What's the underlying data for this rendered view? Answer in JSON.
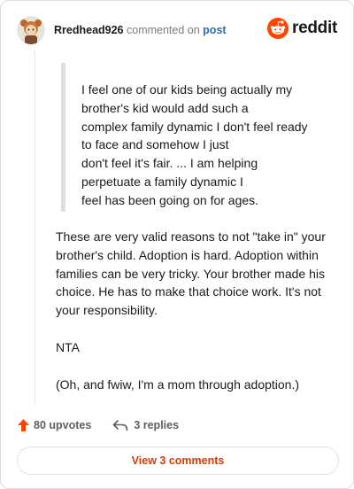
{
  "header": {
    "username": "Rredhead926",
    "action_text": "commented on",
    "post_link": "post",
    "brand": "reddit"
  },
  "colors": {
    "accent": "#d93a00",
    "upvote": "#ff4500",
    "link": "#2e6bb4"
  },
  "quote": {
    "lines": [
      "I feel one of our kids being actually my",
      "brother's kid would add such a",
      "complex family dynamic I don't feel ready",
      "to face and somehow I just",
      "don't feel it's fair. ... I am helping",
      "perpetuate a family dynamic I",
      "feel has been going on for ages."
    ]
  },
  "comment": {
    "paragraphs": [
      "These are very valid reasons to not \"take in\" your brother's child. Adoption is hard. Adoption within families can be very tricky. Your brother made his choice. He has to make that choice work. It's not your responsibility.",
      "NTA",
      "(Oh, and fwiw, I'm a mom through adoption.)"
    ]
  },
  "footer": {
    "upvotes_label": "80 upvotes",
    "replies_label": "3 replies",
    "view_comments_label": "View 3 comments"
  },
  "icons": {
    "avatar": "avatar-icon",
    "brand": "reddit-logo-icon",
    "upvote": "upvote-arrow-icon",
    "reply": "reply-arrow-icon"
  }
}
